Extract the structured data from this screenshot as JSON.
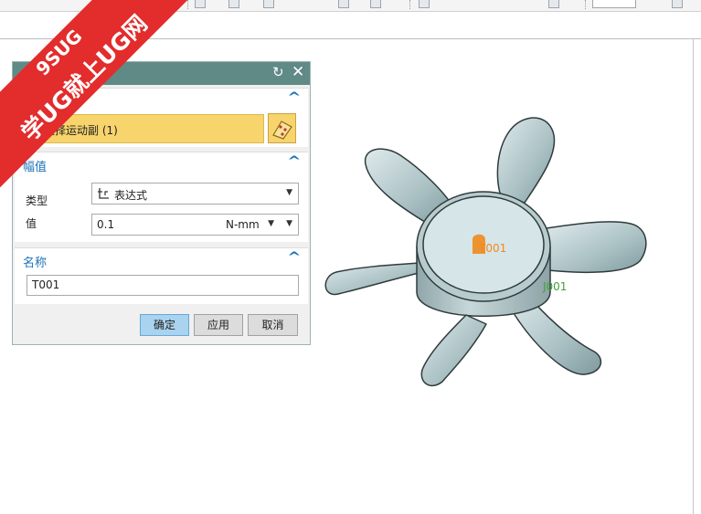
{
  "watermark": {
    "line1": "9SUG",
    "line2": "学UG就上UG网"
  },
  "dialog": {
    "title": "矩",
    "reset_icon": "reset-icon",
    "close_icon": "close-icon",
    "motion_group": {
      "header": "副",
      "selection_label": "选择运动副 (1)",
      "select_icon": "select-object-icon"
    },
    "magnitude_group": {
      "header": "幅值",
      "type_label": "类型",
      "type_value": "表达式",
      "value_label": "值",
      "value": "0.1",
      "unit": "N-mm"
    },
    "name_group": {
      "header": "名称",
      "name_value": "T001"
    },
    "buttons": {
      "ok": "确定",
      "apply": "应用",
      "cancel": "取消"
    }
  },
  "viewport": {
    "torque_label": "T001",
    "joint_label": "J001",
    "accent_color": "#f08a1c",
    "joint_color": "#44a03a"
  }
}
